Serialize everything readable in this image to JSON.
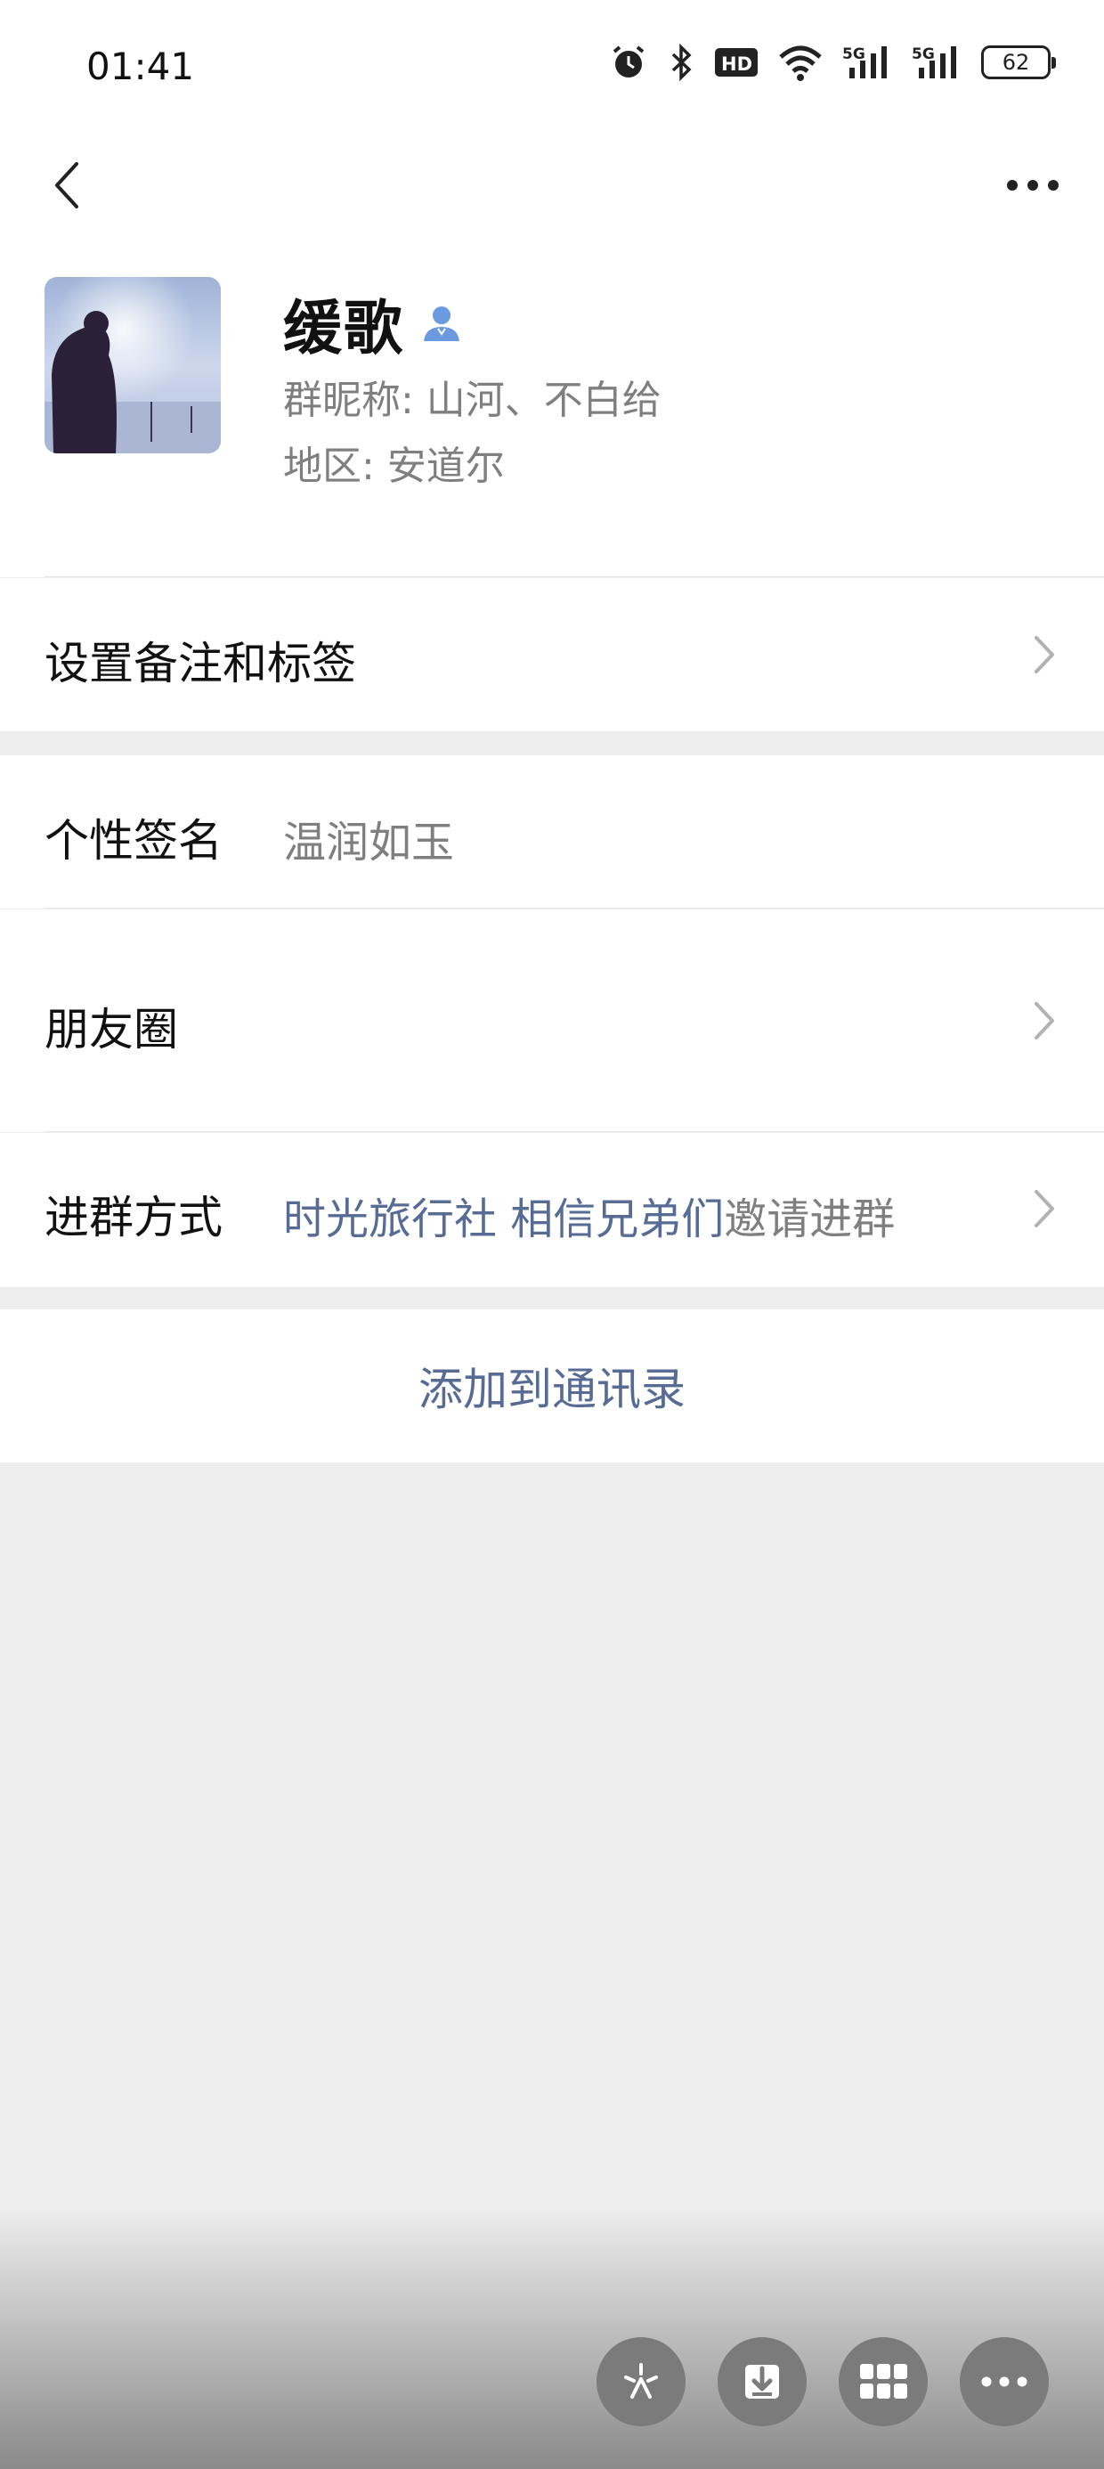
{
  "status_bar": {
    "time": "01:41",
    "battery": "62",
    "icons": [
      "alarm-icon",
      "bluetooth-icon",
      "hd-icon",
      "wifi-icon",
      "5g-signal-icon",
      "5g-signal-icon"
    ]
  },
  "nav": {
    "back_icon": "chevron-left-icon",
    "more_icon": "more-horizontal-icon"
  },
  "profile": {
    "name": "缓歌",
    "group_nickname": "群昵称:  山河、不白给",
    "region": "地区:  安道尔"
  },
  "rows": {
    "remark_label": "设置备注和标签",
    "signature_label": "个性签名",
    "signature_value": "温润如玉",
    "moments_label": "朋友圈",
    "join_label": "进群方式",
    "join_group_name": "时光旅行社 相信兄弟们",
    "join_suffix": "邀请进群"
  },
  "actions": {
    "add_contact": "添加到通讯录"
  },
  "floating_buttons": [
    "sparkle-icon",
    "download-icon",
    "grid-icon",
    "more-icon"
  ],
  "colors": {
    "link_blue": "#576b95",
    "verify_icon": "#6b9ae0"
  }
}
